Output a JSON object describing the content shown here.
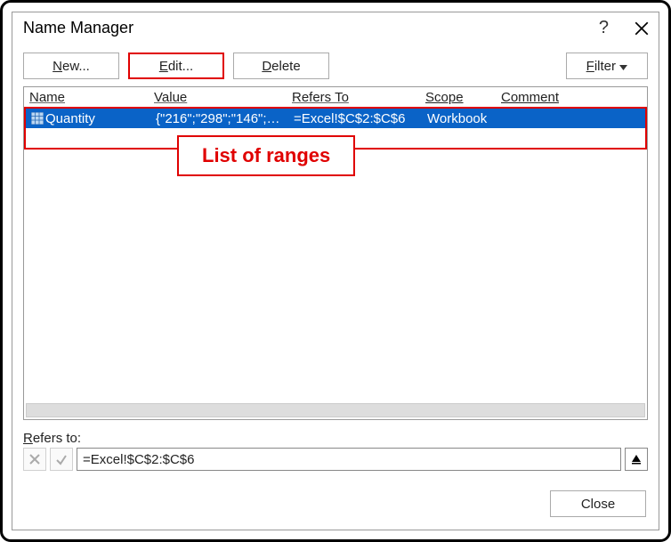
{
  "title": "Name Manager",
  "buttons": {
    "new": "New...",
    "edit": "Edit...",
    "delete": "Delete",
    "filter": "Filter",
    "close": "Close"
  },
  "columns": {
    "name": "Name",
    "value": "Value",
    "refers": "Refers To",
    "scope": "Scope",
    "comment": "Comment"
  },
  "rows": [
    {
      "name": "Quantity",
      "value": "{\"216\";\"298\";\"146\";\"18...",
      "refers": "=Excel!$C$2:$C$6",
      "scope": "Workbook",
      "comment": ""
    }
  ],
  "annotation": "List of ranges",
  "refers_to": {
    "label": "Refers to:",
    "value": "=Excel!$C$2:$C$6"
  }
}
